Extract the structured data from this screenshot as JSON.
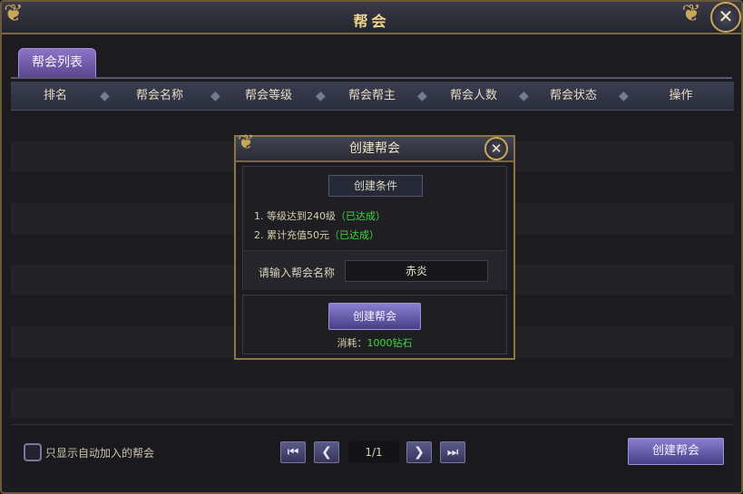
{
  "window": {
    "title": "帮会"
  },
  "tabs": [
    {
      "label": "帮会列表",
      "active": true
    }
  ],
  "table": {
    "headers": [
      "排名",
      "帮会名称",
      "帮会等级",
      "帮会帮主",
      "帮会人数",
      "帮会状态",
      "操作"
    ],
    "rows": []
  },
  "dialog": {
    "title": "创建帮会",
    "conditions_title": "创建条件",
    "conditions": [
      {
        "text": "1. 等级达到240级",
        "status": "（已达成）"
      },
      {
        "text": "2. 累计充值50元",
        "status": "（已达成）"
      }
    ],
    "name_label": "请输入帮会名称",
    "name_value": "赤炎",
    "create_button": "创建帮会",
    "cost_label": "消耗：",
    "cost_value": "1000钻石"
  },
  "footer": {
    "checkbox_label": "只显示自动加入的帮会",
    "page_text": "1/1",
    "create_button": "创建帮会"
  },
  "icons": {
    "close": "close-icon",
    "first": "first-page-icon",
    "prev": "prev-page-icon",
    "next": "next-page-icon",
    "last": "last-page-icon"
  },
  "colors": {
    "gold": "#c9a65a",
    "green_status": "#3fd93c",
    "purple_button": "#8a7fd0"
  }
}
